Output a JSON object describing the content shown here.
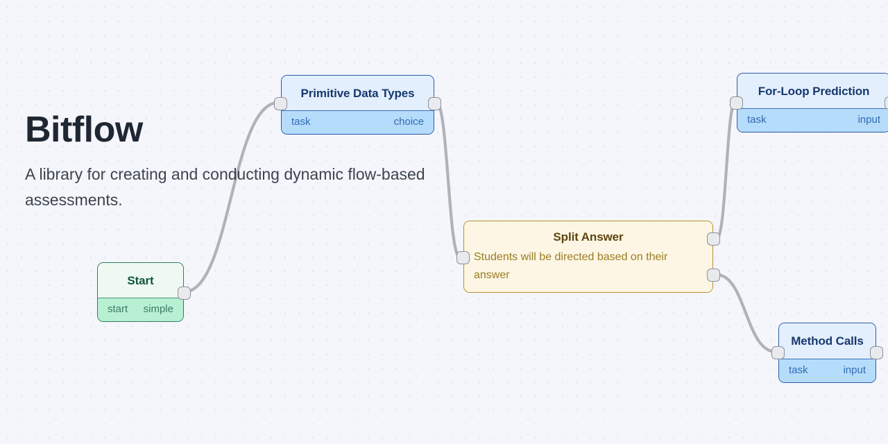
{
  "branding": {
    "title": "Bitflow",
    "subtitle": "A library for creating and conducting dynamic flow-based assessments."
  },
  "canvas": {
    "background_color": "#f4f6fb",
    "dot_color": "#e2e4ed",
    "edge_color": "#b1b1b7"
  },
  "nodes": [
    {
      "id": "start",
      "title": "Start",
      "meta_left": "start",
      "meta_right": "simple",
      "variant": "green",
      "accent": "#2e7d63"
    },
    {
      "id": "primitive-data-types",
      "title": "Primitive Data Types",
      "meta_left": "task",
      "meta_right": "choice",
      "variant": "blue",
      "accent": "#2a5aa8"
    },
    {
      "id": "split-answer",
      "title": "Split Answer",
      "body": "Students will be directed based on their answer",
      "variant": "amber",
      "accent": "#b8902f"
    },
    {
      "id": "for-loop-prediction",
      "title": "For-Loop Prediction",
      "meta_left": "task",
      "meta_right": "input",
      "variant": "blue",
      "accent": "#2a5aa8"
    },
    {
      "id": "method-calls",
      "title": "Method Calls",
      "meta_left": "task",
      "meta_right": "input",
      "variant": "blue",
      "accent": "#2a5aa8"
    }
  ]
}
